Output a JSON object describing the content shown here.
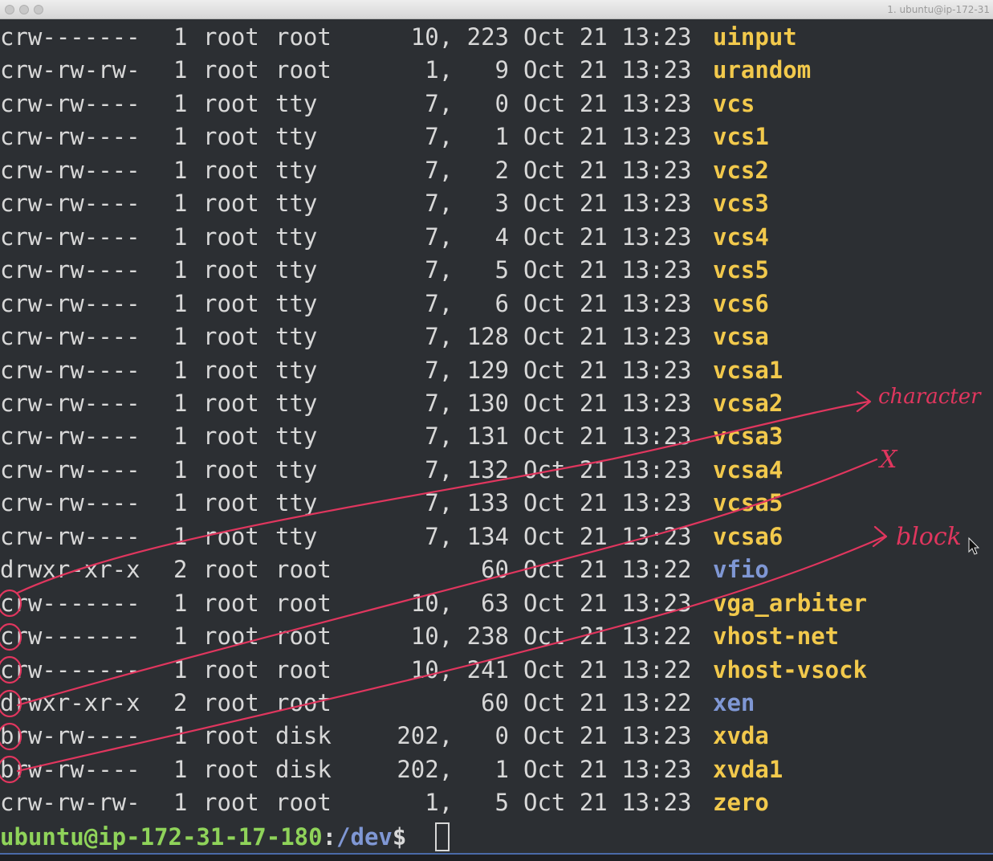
{
  "window": {
    "title": "1. ubuntu@ip-172-31"
  },
  "listing": [
    {
      "perm": "crw-------",
      "links": "1",
      "owner": "root",
      "group": "root",
      "size": "10, 223",
      "date": "Oct 21 13:23",
      "name": "uinput",
      "type": "device"
    },
    {
      "perm": "crw-rw-rw-",
      "links": "1",
      "owner": "root",
      "group": "root",
      "size": "1,   9",
      "date": "Oct 21 13:23",
      "name": "urandom",
      "type": "device"
    },
    {
      "perm": "crw-rw----",
      "links": "1",
      "owner": "root",
      "group": "tty",
      "size": "7,   0",
      "date": "Oct 21 13:23",
      "name": "vcs",
      "type": "device"
    },
    {
      "perm": "crw-rw----",
      "links": "1",
      "owner": "root",
      "group": "tty",
      "size": "7,   1",
      "date": "Oct 21 13:23",
      "name": "vcs1",
      "type": "device"
    },
    {
      "perm": "crw-rw----",
      "links": "1",
      "owner": "root",
      "group": "tty",
      "size": "7,   2",
      "date": "Oct 21 13:23",
      "name": "vcs2",
      "type": "device"
    },
    {
      "perm": "crw-rw----",
      "links": "1",
      "owner": "root",
      "group": "tty",
      "size": "7,   3",
      "date": "Oct 21 13:23",
      "name": "vcs3",
      "type": "device"
    },
    {
      "perm": "crw-rw----",
      "links": "1",
      "owner": "root",
      "group": "tty",
      "size": "7,   4",
      "date": "Oct 21 13:23",
      "name": "vcs4",
      "type": "device"
    },
    {
      "perm": "crw-rw----",
      "links": "1",
      "owner": "root",
      "group": "tty",
      "size": "7,   5",
      "date": "Oct 21 13:23",
      "name": "vcs5",
      "type": "device"
    },
    {
      "perm": "crw-rw----",
      "links": "1",
      "owner": "root",
      "group": "tty",
      "size": "7,   6",
      "date": "Oct 21 13:23",
      "name": "vcs6",
      "type": "device"
    },
    {
      "perm": "crw-rw----",
      "links": "1",
      "owner": "root",
      "group": "tty",
      "size": "7, 128",
      "date": "Oct 21 13:23",
      "name": "vcsa",
      "type": "device"
    },
    {
      "perm": "crw-rw----",
      "links": "1",
      "owner": "root",
      "group": "tty",
      "size": "7, 129",
      "date": "Oct 21 13:23",
      "name": "vcsa1",
      "type": "device"
    },
    {
      "perm": "crw-rw----",
      "links": "1",
      "owner": "root",
      "group": "tty",
      "size": "7, 130",
      "date": "Oct 21 13:23",
      "name": "vcsa2",
      "type": "device"
    },
    {
      "perm": "crw-rw----",
      "links": "1",
      "owner": "root",
      "group": "tty",
      "size": "7, 131",
      "date": "Oct 21 13:23",
      "name": "vcsa3",
      "type": "device"
    },
    {
      "perm": "crw-rw----",
      "links": "1",
      "owner": "root",
      "group": "tty",
      "size": "7, 132",
      "date": "Oct 21 13:23",
      "name": "vcsa4",
      "type": "device"
    },
    {
      "perm": "crw-rw----",
      "links": "1",
      "owner": "root",
      "group": "tty",
      "size": "7, 133",
      "date": "Oct 21 13:23",
      "name": "vcsa5",
      "type": "device"
    },
    {
      "perm": "crw-rw----",
      "links": "1",
      "owner": "root",
      "group": "tty",
      "size": "7, 134",
      "date": "Oct 21 13:23",
      "name": "vcsa6",
      "type": "device"
    },
    {
      "perm": "drwxr-xr-x",
      "links": "2",
      "owner": "root",
      "group": "root",
      "size": "60",
      "date": "Oct 21 13:22",
      "name": "vfio",
      "type": "dir"
    },
    {
      "perm": "crw-------",
      "links": "1",
      "owner": "root",
      "group": "root",
      "size": "10,  63",
      "date": "Oct 21 13:23",
      "name": "vga_arbiter",
      "type": "device"
    },
    {
      "perm": "crw-------",
      "links": "1",
      "owner": "root",
      "group": "root",
      "size": "10, 238",
      "date": "Oct 21 13:22",
      "name": "vhost-net",
      "type": "device"
    },
    {
      "perm": "crw-------",
      "links": "1",
      "owner": "root",
      "group": "root",
      "size": "10, 241",
      "date": "Oct 21 13:22",
      "name": "vhost-vsock",
      "type": "device"
    },
    {
      "perm": "drwxr-xr-x",
      "links": "2",
      "owner": "root",
      "group": "root",
      "size": "60",
      "date": "Oct 21 13:22",
      "name": "xen",
      "type": "dir"
    },
    {
      "perm": "brw-rw----",
      "links": "1",
      "owner": "root",
      "group": "disk",
      "size": "202,   0",
      "date": "Oct 21 13:23",
      "name": "xvda",
      "type": "device"
    },
    {
      "perm": "brw-rw----",
      "links": "1",
      "owner": "root",
      "group": "disk",
      "size": "202,   1",
      "date": "Oct 21 13:23",
      "name": "xvda1",
      "type": "device"
    },
    {
      "perm": "crw-rw-rw-",
      "links": "1",
      "owner": "root",
      "group": "root",
      "size": "1,   5",
      "date": "Oct 21 13:23",
      "name": "zero",
      "type": "device"
    }
  ],
  "prompt": {
    "user_host": "ubuntu@ip-172-31-17-180",
    "separator": ":",
    "path": "/dev",
    "symbol": "$ "
  },
  "annotations": {
    "color": "#e0365e",
    "character_label": "character",
    "x_label": "X",
    "block_label": "block"
  },
  "colors": {
    "background": "#2c2f33",
    "text": "#d8d8d8",
    "device_name": "#f2c94c",
    "dir_name": "#7f97d4",
    "prompt_user": "#8fd35a",
    "prompt_path": "#7f97d4"
  }
}
